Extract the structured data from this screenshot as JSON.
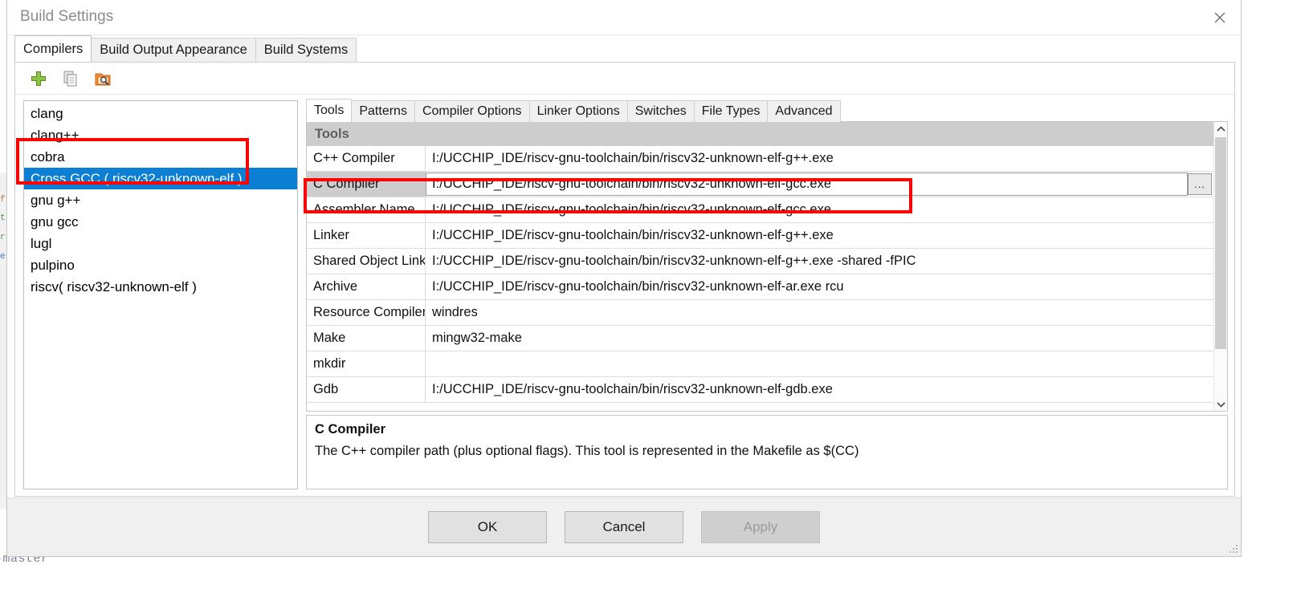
{
  "window": {
    "title": "Build Settings",
    "close_icon": "close-icon"
  },
  "outer_tabs": [
    {
      "label": "Compilers",
      "active": true
    },
    {
      "label": "Build Output Appearance",
      "active": false
    },
    {
      "label": "Build Systems",
      "active": false
    }
  ],
  "toolbar": [
    {
      "icon": "add-icon",
      "title": "Add"
    },
    {
      "icon": "copy-icon",
      "title": "Copy"
    },
    {
      "icon": "find-folder-icon",
      "title": "Browse"
    }
  ],
  "compiler_list": {
    "items": [
      {
        "label": "clang",
        "selected": false
      },
      {
        "label": "clang++",
        "selected": false
      },
      {
        "label": "cobra",
        "selected": false
      },
      {
        "label": "Cross GCC ( riscv32-unknown-elf )",
        "selected": true
      },
      {
        "label": "gnu g++",
        "selected": false
      },
      {
        "label": "gnu gcc",
        "selected": false
      },
      {
        "label": "lugl",
        "selected": false
      },
      {
        "label": "pulpino",
        "selected": false
      },
      {
        "label": "riscv( riscv32-unknown-elf )",
        "selected": false
      }
    ]
  },
  "inner_tabs": [
    {
      "label": "Tools",
      "active": true
    },
    {
      "label": "Patterns",
      "active": false
    },
    {
      "label": "Compiler Options",
      "active": false
    },
    {
      "label": "Linker Options",
      "active": false
    },
    {
      "label": "Switches",
      "active": false
    },
    {
      "label": "File Types",
      "active": false
    },
    {
      "label": "Advanced",
      "active": false
    }
  ],
  "tools_table": {
    "header": "Tools",
    "rows": [
      {
        "name": "C++ Compiler",
        "value": "I:/UCCHIP_IDE/riscv-gnu-toolchain/bin/riscv32-unknown-elf-g++.exe",
        "active": false
      },
      {
        "name": "C Compiler",
        "value": "I:/UCCHIP_IDE/riscv-gnu-toolchain/bin/riscv32-unknown-elf-gcc.exe",
        "active": true
      },
      {
        "name": "Assembler Name",
        "value": "I:/UCCHIP_IDE/riscv-gnu-toolchain/bin/riscv32-unknown-elf-gcc.exe",
        "active": false
      },
      {
        "name": "Linker",
        "value": "I:/UCCHIP_IDE/riscv-gnu-toolchain/bin/riscv32-unknown-elf-g++.exe",
        "active": false
      },
      {
        "name": "Shared Object Linker",
        "value": "I:/UCCHIP_IDE/riscv-gnu-toolchain/bin/riscv32-unknown-elf-g++.exe -shared -fPIC",
        "active": false
      },
      {
        "name": "Archive",
        "value": "I:/UCCHIP_IDE/riscv-gnu-toolchain/bin/riscv32-unknown-elf-ar.exe rcu",
        "active": false
      },
      {
        "name": "Resource Compiler",
        "value": "windres",
        "active": false
      },
      {
        "name": "Make",
        "value": "mingw32-make",
        "active": false
      },
      {
        "name": "mkdir",
        "value": "",
        "active": false
      },
      {
        "name": "Gdb",
        "value": "I:/UCCHIP_IDE/riscv-gnu-toolchain/bin/riscv32-unknown-elf-gdb.exe",
        "active": false
      }
    ],
    "browse_label": "..."
  },
  "description": {
    "title": "C Compiler",
    "text": "The C++ compiler path (plus optional flags). This tool is represented in the Makefile as $(CC)"
  },
  "footer": {
    "ok": "OK",
    "cancel": "Cancel",
    "apply": "Apply"
  },
  "background": {
    "console_line_1": "-master'",
    "console_line_2": ""
  },
  "colors": {
    "selection_blue": "#0a7fd4",
    "annotation_red": "#fe0000",
    "header_gray": "#cdcdcd"
  }
}
